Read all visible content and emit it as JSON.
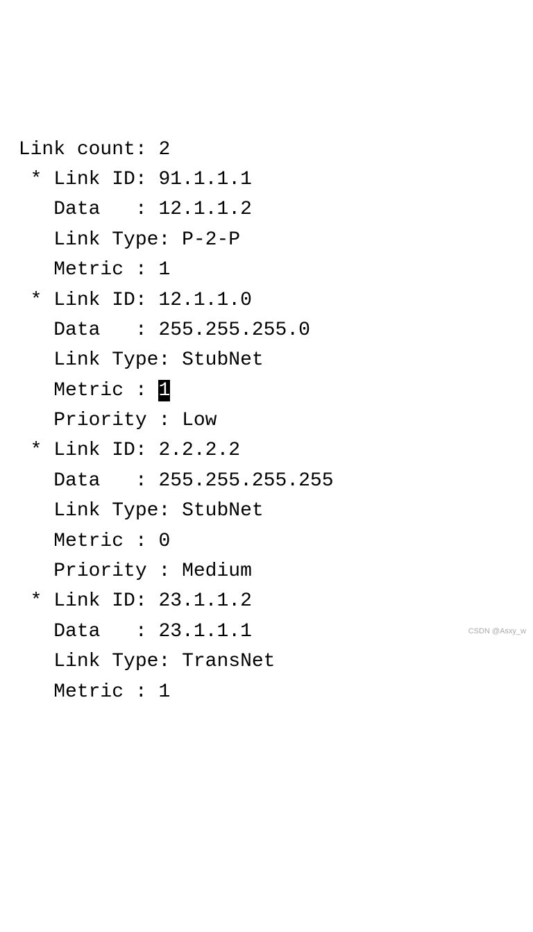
{
  "header": {
    "link_count_label": "Link count",
    "link_count_value": "2"
  },
  "links": [
    {
      "link_id_label": "Link ID",
      "link_id_value": "91.1.1.1",
      "data_label": "Data   ",
      "data_value": "12.1.1.2",
      "link_type_label": "Link Type",
      "link_type_value": "P-2-P",
      "metric_label": "Metric ",
      "metric_value": "1",
      "metric_highlighted": false,
      "priority_label": null,
      "priority_value": null
    },
    {
      "link_id_label": "Link ID",
      "link_id_value": "12.1.1.0",
      "data_label": "Data   ",
      "data_value": "255.255.255.0",
      "link_type_label": "Link Type",
      "link_type_value": "StubNet",
      "metric_label": "Metric ",
      "metric_value": "1",
      "metric_highlighted": true,
      "priority_label": "Priority ",
      "priority_value": "Low"
    },
    {
      "link_id_label": "Link ID",
      "link_id_value": "2.2.2.2",
      "data_label": "Data   ",
      "data_value": "255.255.255.255",
      "link_type_label": "Link Type",
      "link_type_value": "StubNet",
      "metric_label": "Metric ",
      "metric_value": "0",
      "metric_highlighted": false,
      "priority_label": "Priority ",
      "priority_value": "Medium"
    },
    {
      "link_id_label": "Link ID",
      "link_id_value": "23.1.1.2",
      "data_label": "Data   ",
      "data_value": "23.1.1.1",
      "link_type_label": "Link Type",
      "link_type_value": "TransNet",
      "metric_label": "Metric ",
      "metric_value": "1",
      "metric_highlighted": false,
      "priority_label": null,
      "priority_value": null
    }
  ],
  "watermark": "CSDN @Asxy_w"
}
